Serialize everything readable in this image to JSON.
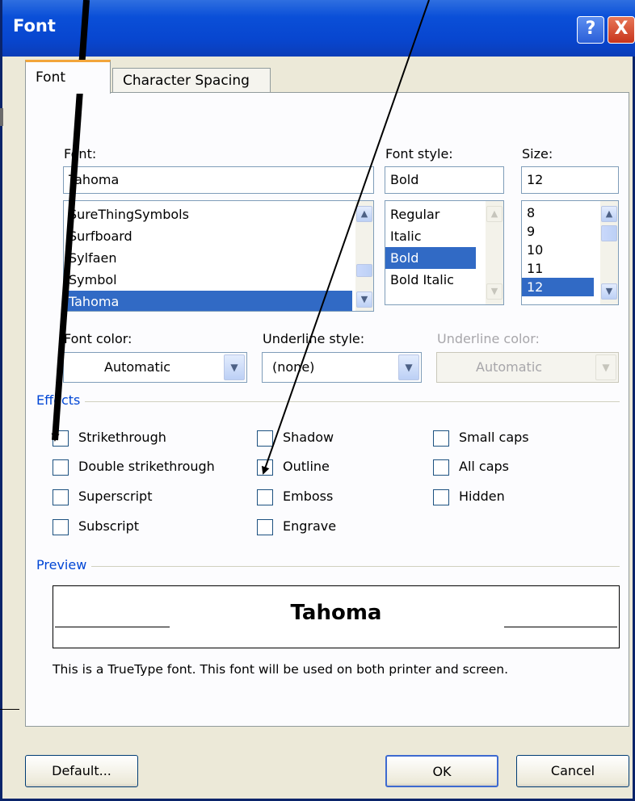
{
  "window": {
    "title": "Font"
  },
  "titlebar": {
    "help_glyph": "?",
    "close_glyph": "X"
  },
  "tabs": [
    {
      "label": "Font",
      "active": true
    },
    {
      "label": "Character Spacing",
      "active": false
    }
  ],
  "font": {
    "label": "Font:",
    "value": "Tahoma",
    "items": [
      "SureThingSymbols",
      "Surfboard",
      "Sylfaen",
      "Symbol",
      "Tahoma"
    ],
    "selected": "Tahoma"
  },
  "font_style": {
    "label": "Font style:",
    "value": "Bold",
    "items": [
      "Regular",
      "Italic",
      "Bold",
      "Bold Italic"
    ],
    "selected": "Bold"
  },
  "size": {
    "label": "Size:",
    "value": "12",
    "items": [
      "8",
      "9",
      "10",
      "11",
      "12"
    ],
    "selected": "12"
  },
  "font_color": {
    "label": "Font color:",
    "value": "Automatic"
  },
  "underline_style": {
    "label": "Underline style:",
    "value": "(none)"
  },
  "underline_color": {
    "label": "Underline color:",
    "value": "Automatic",
    "disabled": true
  },
  "effects": {
    "title": "Effects",
    "options": [
      {
        "label": "Strikethrough",
        "checked": false
      },
      {
        "label": "Double strikethrough",
        "checked": false
      },
      {
        "label": "Superscript",
        "checked": false
      },
      {
        "label": "Subscript",
        "checked": false
      },
      {
        "label": "Shadow",
        "checked": false
      },
      {
        "label": "Outline",
        "checked": false
      },
      {
        "label": "Emboss",
        "checked": false
      },
      {
        "label": "Engrave",
        "checked": false
      },
      {
        "label": "Small caps",
        "checked": false
      },
      {
        "label": "All caps",
        "checked": false
      },
      {
        "label": "Hidden",
        "checked": false
      }
    ]
  },
  "preview": {
    "title": "Preview",
    "sample": "Tahoma",
    "description": "This is a TrueType font. This font will be used on both printer and screen."
  },
  "buttons": {
    "default": "Default...",
    "ok": "OK",
    "cancel": "Cancel"
  },
  "colors": {
    "titlebar": "#0a4fd8",
    "selection": "#316ac5",
    "group_title": "#0046d5",
    "tab_highlight": "#f2a53a"
  },
  "icons": {
    "help": "help-icon",
    "close": "close-icon",
    "scroll_up": "scroll-up-arrow-icon",
    "scroll_down": "scroll-down-arrow-icon",
    "dropdown": "chevron-down-icon"
  }
}
